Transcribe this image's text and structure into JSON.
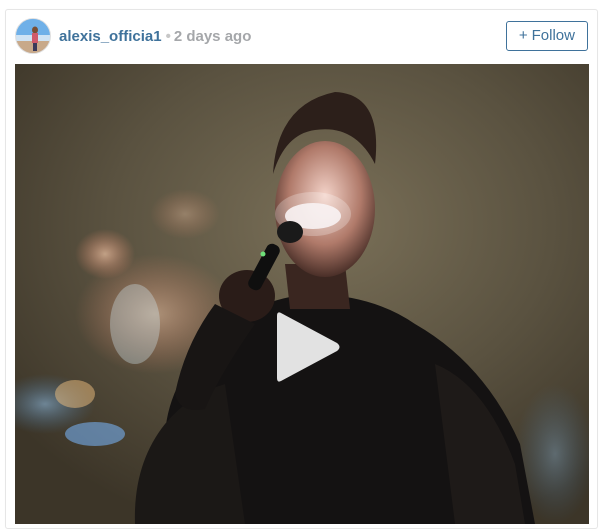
{
  "post": {
    "username": "alexis_officia1",
    "separator": "•",
    "timestamp": "2 days ago",
    "follow_label": "Follow",
    "follow_icon": "plus-icon"
  },
  "media": {
    "type": "video",
    "play_icon": "play-icon"
  },
  "colors": {
    "link": "#3f729b",
    "muted": "#a5a7aa",
    "border": "#e6e6e6"
  }
}
